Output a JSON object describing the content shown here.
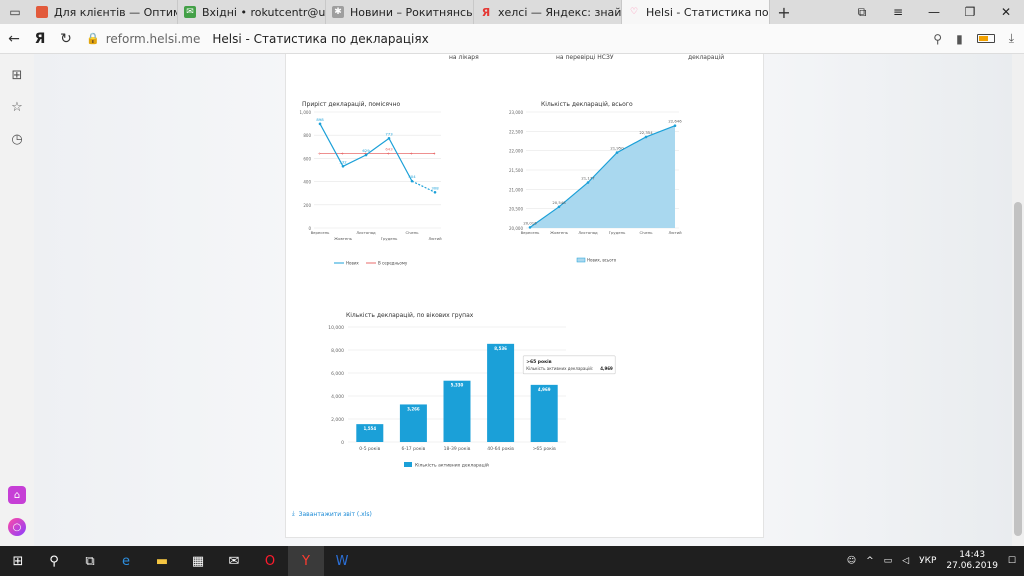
{
  "tabs": [
    {
      "title": "Для клієнтів — Оптимальн",
      "favicon_color": "#e25a3b"
    },
    {
      "title": "Вхідні • rokutcentr@ukr.net",
      "favicon_color": "#43a047"
    },
    {
      "title": "Новини – Рокитнянський",
      "favicon_color": "#9e9e9e"
    },
    {
      "title": "хелсі — Яндекс: знайшлос",
      "favicon_color": "#e53935"
    },
    {
      "title": "Helsi - Статистика по де",
      "favicon_color": "#ff7aa8"
    }
  ],
  "address": {
    "domain": "reform.helsi.me",
    "page_title": "Helsi - Статистика по деклараціях"
  },
  "top_labels": [
    "на лікаря",
    "на перевірці НСЗУ",
    "декларацій"
  ],
  "chart_data": [
    {
      "type": "line",
      "title": "Приріст декларацій, помісячно",
      "categories": [
        "Вересень",
        "Жовтень",
        "Листопад",
        "Грудень",
        "Січень",
        "Лютий"
      ],
      "ylim": [
        0,
        1000
      ],
      "yticks": [
        "0",
        "200",
        "400",
        "600",
        "800",
        "1,000"
      ],
      "series": [
        {
          "name": "Нових",
          "values": [
            898,
            532,
            629,
            773,
            404,
            308
          ],
          "color": "#1ba0d8"
        },
        {
          "name": "В середньому",
          "values": [
            643,
            643,
            643,
            643,
            643,
            643
          ],
          "color": "#e86b6b"
        }
      ],
      "average_label": "643",
      "grid": true
    },
    {
      "type": "area",
      "title": "Кількість декларацій, всього",
      "categories": [
        "Вересень",
        "Жовтень",
        "Листопад",
        "Грудень",
        "Січень",
        "Лютий"
      ],
      "ylim": [
        20000,
        23000
      ],
      "yticks": [
        "20,000",
        "20,500",
        "21,000",
        "21,500",
        "22,000",
        "22,500",
        "23,000"
      ],
      "series": [
        {
          "name": "Нових, всього",
          "values": [
            20016,
            20548,
            21177,
            21950,
            22354,
            22646
          ],
          "color": "#1ba0d8"
        }
      ],
      "data_labels": [
        "20,016",
        "20,548",
        "21,177",
        "21,950",
        "22,354",
        "22,646"
      ],
      "grid": true
    },
    {
      "type": "bar",
      "title": "Кількість декларацій, по вікових групах",
      "categories": [
        "0-5 років",
        "6-17 років",
        "18-39 років",
        "40-64 років",
        ">65 років"
      ],
      "ylim": [
        0,
        10000
      ],
      "yticks": [
        "0",
        "2,000",
        "4,000",
        "6,000",
        "8,000",
        "10,000"
      ],
      "series": [
        {
          "name": "Кількість активних декларацій",
          "values": [
            1554,
            3266,
            5330,
            8536,
            4969
          ],
          "color": "#1ba0d8"
        }
      ],
      "data_labels": [
        "1,554",
        "3,266",
        "5,330",
        "8,536",
        "4,969"
      ],
      "tooltip": {
        "title": ">65 років",
        "label": "Кількість активних декларацій:",
        "value": "4,969"
      },
      "grid": true
    }
  ],
  "download_label": "Завантажити звіт (.xls)",
  "taskbar": {
    "time": "14:43",
    "date": "27.06.2019",
    "lang": "УКР"
  }
}
